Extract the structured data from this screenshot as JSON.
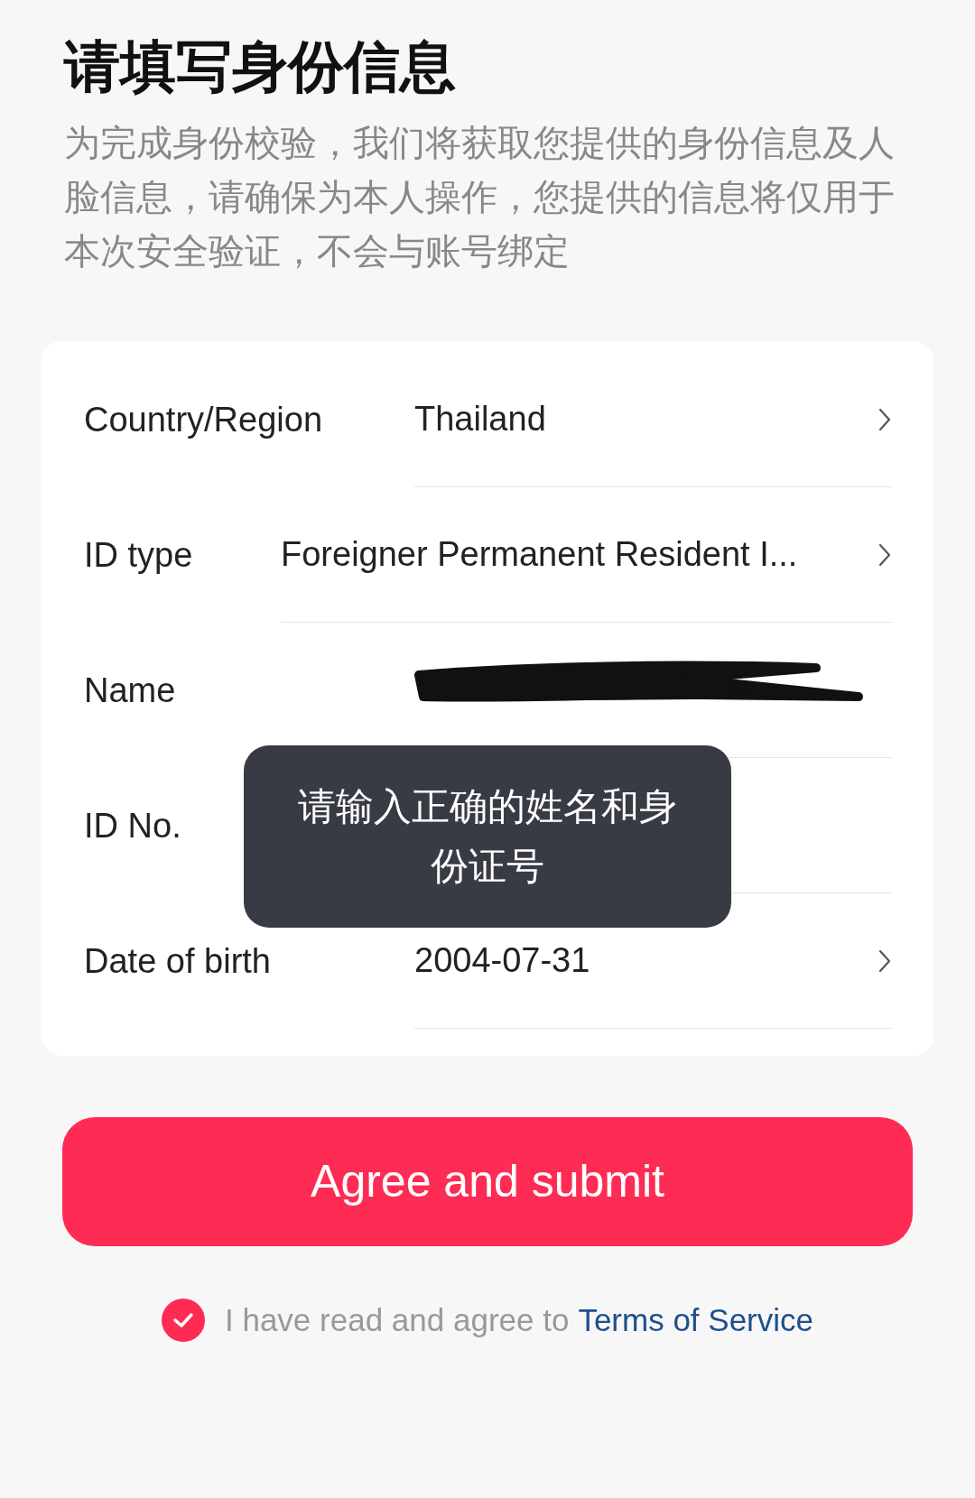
{
  "title": "请填写身份信息",
  "description": "为完成身份校验，我们将获取您提供的身份信息及人脸信息，请确保为本人操作，您提供的信息将仅用于本次安全验证，不会与账号绑定",
  "form": {
    "rows": [
      {
        "label": "Country/Region",
        "value": "Thailand",
        "kind": "select"
      },
      {
        "label": "ID type",
        "value": "Foreigner Permanent Resident I...",
        "kind": "select"
      },
      {
        "label": "Name",
        "kind": "redacted"
      },
      {
        "label": "ID No.",
        "kind": "hidden"
      },
      {
        "label": "Date of birth",
        "value": "2004-07-31",
        "kind": "select"
      }
    ]
  },
  "toast": "请输入正确的姓名和身份证号",
  "submit_button": "Agree and submit",
  "agreement": {
    "checked": true,
    "text": "I have read and agree to",
    "link": "Terms of Service"
  }
}
